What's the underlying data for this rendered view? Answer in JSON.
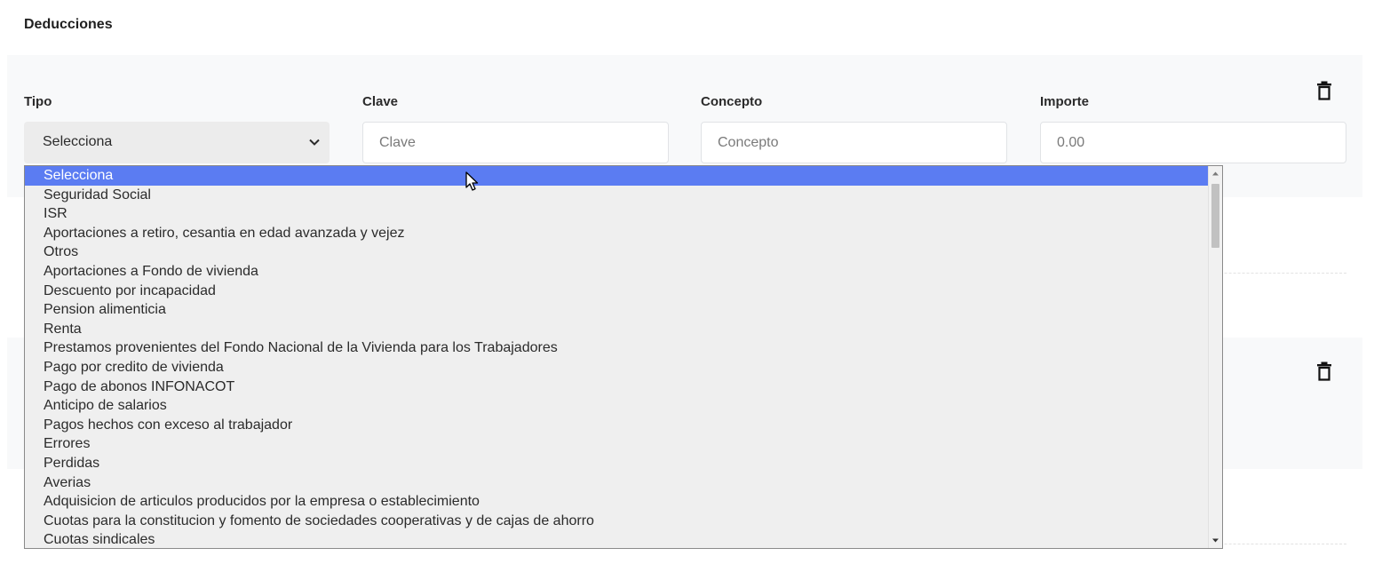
{
  "section": {
    "title": "Deducciones"
  },
  "form": {
    "tipo_label": "Tipo",
    "clave_label": "Clave",
    "concepto_label": "Concepto",
    "importe_label": "Importe",
    "tipo_selected": "Selecciona",
    "clave_placeholder": "Clave",
    "concepto_placeholder": "Concepto",
    "importe_placeholder": "0.00"
  },
  "dropdown": {
    "options": [
      "Selecciona",
      "Seguridad Social",
      "ISR",
      "Aportaciones a retiro, cesantia en edad avanzada y vejez",
      "Otros",
      "Aportaciones a Fondo de vivienda",
      "Descuento por incapacidad",
      "Pension alimenticia",
      "Renta",
      "Prestamos provenientes del Fondo Nacional de la Vivienda para los Trabajadores",
      "Pago por credito de vivienda",
      "Pago de abonos INFONACOT",
      "Anticipo de salarios",
      "Pagos hechos con exceso al trabajador",
      "Errores",
      "Perdidas",
      "Averias",
      "Adquisicion de articulos producidos por la empresa o establecimiento",
      "Cuotas para la constitucion y fomento de sociedades cooperativas y de cajas de ahorro",
      "Cuotas sindicales"
    ],
    "highlighted_option": "Selecciona"
  },
  "icons": {
    "delete": "trash-icon",
    "chevron": "chevron-down-icon",
    "cursor": "mouse-pointer-icon"
  },
  "colors": {
    "highlight": "#5b7cf2",
    "card_background": "#f8f9fa",
    "select_background": "#ececec"
  }
}
